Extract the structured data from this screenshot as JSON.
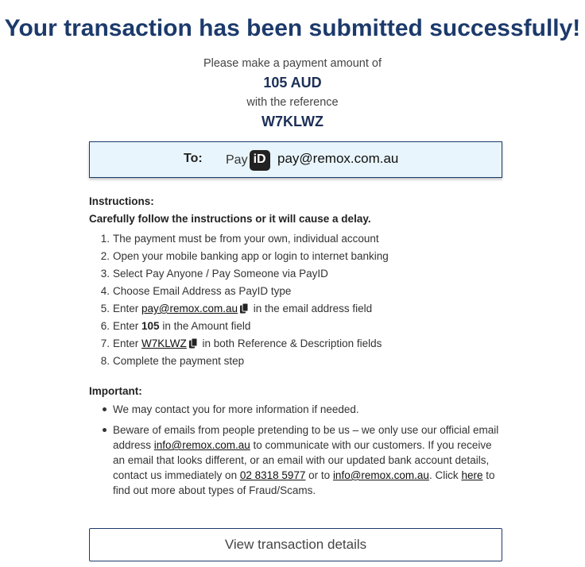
{
  "header": {
    "title": "Your transaction has been submitted successfully!"
  },
  "payment": {
    "prompt": "Please make a payment amount of",
    "amount": "105 AUD",
    "reference_prompt": "with the reference",
    "reference": "W7KLWZ"
  },
  "to_box": {
    "label": "To:",
    "logo_text": "Pay",
    "logo_mark": "iD",
    "email": "pay@remox.com.au"
  },
  "instructions": {
    "heading": "Instructions:",
    "warning": "Carefully follow the instructions or it will cause a delay.",
    "steps": [
      {
        "num": "1.",
        "text": "The payment must be from your own, individual account"
      },
      {
        "num": "2.",
        "text": "Open your mobile banking app or login to internet banking"
      },
      {
        "num": "3.",
        "text": "Select Pay Anyone / Pay Someone via PayID"
      },
      {
        "num": "4.",
        "text": "Choose Email Address as PayID type"
      },
      {
        "num": "5.",
        "pre": "Enter ",
        "link": "pay@remox.com.au",
        "post": " in the email address field"
      },
      {
        "num": "6.",
        "pre": "Enter ",
        "bold": "105",
        "post": " in the Amount field"
      },
      {
        "num": "7.",
        "pre": "Enter ",
        "link": "W7KLWZ",
        "post": " in both Reference & Description fields"
      },
      {
        "num": "8.",
        "text": "Complete the payment step"
      }
    ]
  },
  "important": {
    "heading": "Important:",
    "item1": "We may contact you for more information if needed.",
    "item2": {
      "t1": "Beware of emails from people pretending to be us – we only use our official email address ",
      "email_link": "info@remox.com.au",
      "t2": " to communicate with our customers. If you receive an email that looks different, or an email with our updated bank account details, contact us immediately on ",
      "phone_link": "02 8318 5977",
      "t3": " or to ",
      "email_link2": "info@remox.com.au",
      "t4": ". Click ",
      "here_link": "here",
      "t5": " to find out more about types of Fraud/Scams."
    }
  },
  "actions": {
    "view_details_label": "View transaction details"
  },
  "colors": {
    "title": "#1c3a6b",
    "box_bg": "#e8f5fc",
    "border": "#1c3a6b"
  },
  "icons": {
    "copy": "copy-icon",
    "payid": "payid-logo"
  }
}
